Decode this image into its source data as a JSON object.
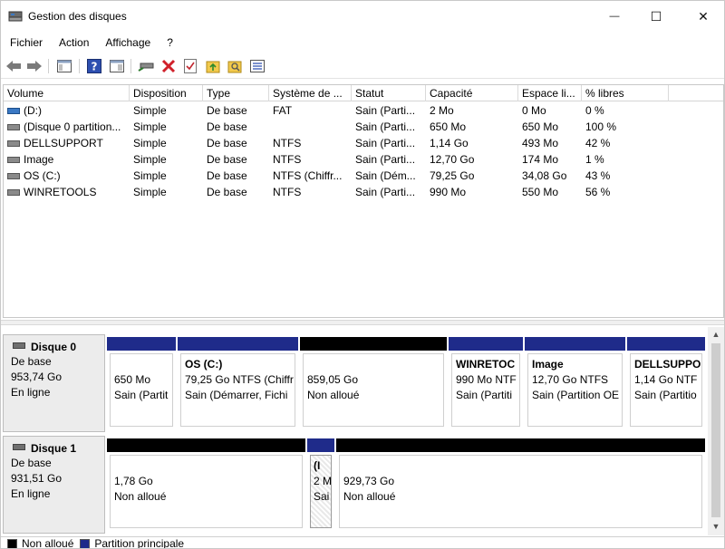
{
  "window": {
    "title": "Gestion des disques",
    "controls": {
      "minimize": "—",
      "maximize": "☐",
      "close": "✕"
    }
  },
  "menu": [
    "Fichier",
    "Action",
    "Affichage",
    "?"
  ],
  "toolbar": {
    "icons": [
      "back-arrow-icon",
      "forward-arrow-icon",
      "console-tree-icon",
      "help-icon",
      "properties-pane-icon",
      "connect-drive-icon",
      "delete-icon",
      "check-properties-icon",
      "open-folder-icon",
      "search-folder-icon",
      "volume-list-icon"
    ]
  },
  "volume_list": {
    "columns": [
      "Volume",
      "Disposition",
      "Type",
      "Système de ...",
      "Statut",
      "Capacité",
      "Espace li...",
      "% libres"
    ],
    "rows": [
      {
        "icon": "blue",
        "volume": "(D:)",
        "disposition": "Simple",
        "type": "De base",
        "fs": "FAT",
        "status": "Sain (Parti...",
        "capacity": "2 Mo",
        "free": "0 Mo",
        "pct": "0 %"
      },
      {
        "icon": "gray",
        "volume": "(Disque 0 partition...",
        "disposition": "Simple",
        "type": "De base",
        "fs": "",
        "status": "Sain (Parti...",
        "capacity": "650 Mo",
        "free": "650 Mo",
        "pct": "100 %"
      },
      {
        "icon": "gray",
        "volume": "DELLSUPPORT",
        "disposition": "Simple",
        "type": "De base",
        "fs": "NTFS",
        "status": "Sain (Parti...",
        "capacity": "1,14 Go",
        "free": "493 Mo",
        "pct": "42 %"
      },
      {
        "icon": "gray",
        "volume": "Image",
        "disposition": "Simple",
        "type": "De base",
        "fs": "NTFS",
        "status": "Sain (Parti...",
        "capacity": "12,70 Go",
        "free": "174 Mo",
        "pct": "1 %"
      },
      {
        "icon": "gray",
        "volume": "OS (C:)",
        "disposition": "Simple",
        "type": "De base",
        "fs": "NTFS (Chiffr...",
        "status": "Sain (Dém...",
        "capacity": "79,25 Go",
        "free": "34,08 Go",
        "pct": "43 %"
      },
      {
        "icon": "gray",
        "volume": "WINRETOOLS",
        "disposition": "Simple",
        "type": "De base",
        "fs": "NTFS",
        "status": "Sain (Parti...",
        "capacity": "990 Mo",
        "free": "550 Mo",
        "pct": "56 %"
      }
    ]
  },
  "disks": [
    {
      "name": "Disque 0",
      "type": "De base",
      "size": "953,74 Go",
      "state": "En ligne",
      "partitions": [
        {
          "kind": "primary",
          "name": "",
          "line1": "650 Mo",
          "line2": "Sain (Partit"
        },
        {
          "kind": "primary",
          "name": "OS  (C:)",
          "line1": "79,25 Go NTFS (Chiffr",
          "line2": "Sain (Démarrer, Fichi"
        },
        {
          "kind": "unalloc",
          "name": "",
          "line1": "859,05 Go",
          "line2": "Non alloué"
        },
        {
          "kind": "primary",
          "name": "WINRETOC",
          "line1": "990 Mo NTF",
          "line2": "Sain (Partiti"
        },
        {
          "kind": "primary",
          "name": "Image",
          "line1": "12,70 Go NTFS",
          "line2": "Sain (Partition OE"
        },
        {
          "kind": "primary",
          "name": "DELLSUPPO",
          "line1": "1,14 Go NTF",
          "line2": "Sain (Partitio"
        }
      ]
    },
    {
      "name": "Disque 1",
      "type": "De base",
      "size": "931,51 Go",
      "state": "En ligne",
      "partitions": [
        {
          "kind": "unalloc",
          "name": "",
          "line1": "1,78 Go",
          "line2": "Non alloué"
        },
        {
          "kind": "primary",
          "name": "(I",
          "line1": "2 M",
          "line2": "Sai"
        },
        {
          "kind": "unalloc",
          "name": "",
          "line1": "929,73 Go",
          "line2": "Non alloué"
        }
      ]
    }
  ],
  "legend": {
    "unallocated": "Non alloué",
    "primary": "Partition principale",
    "colors": {
      "unallocated": "#000000",
      "primary": "#1f2b8a"
    }
  }
}
